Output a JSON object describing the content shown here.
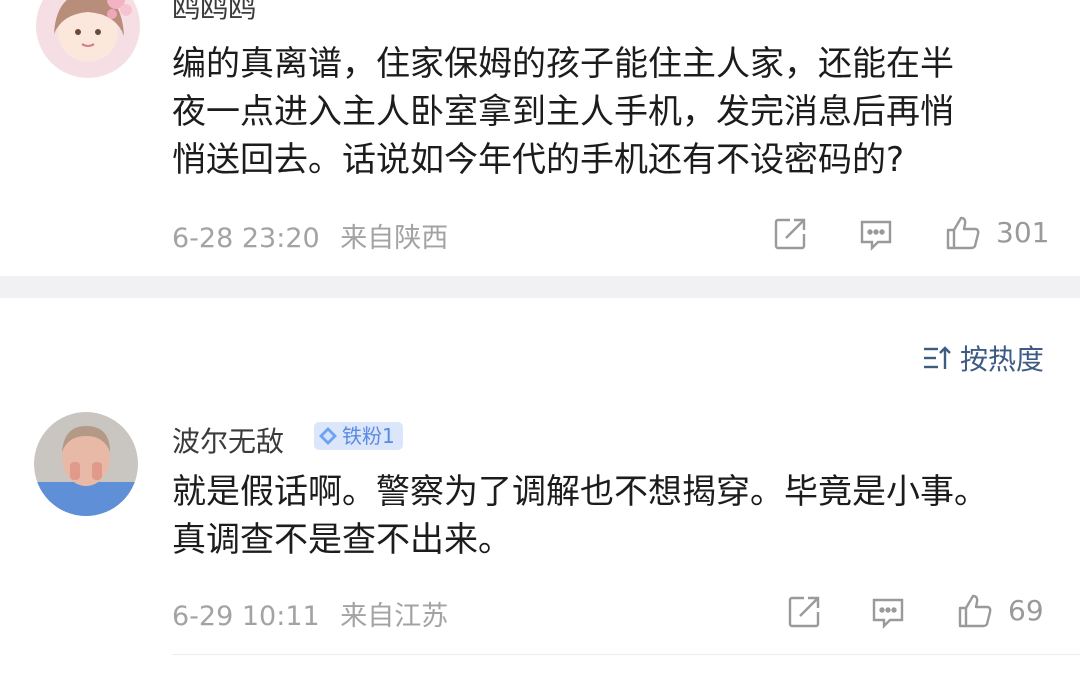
{
  "comments": [
    {
      "username": "鸥鸥鸥",
      "text_lines": [
        "编的真离谱，住家保姆的孩子能住主人家，还能在半",
        "夜一点进入主人卧室拿到主人手机，发完消息后再悄",
        "悄送回去。话说如今年代的手机还有不设密码的?"
      ],
      "time": "6-28 23:20",
      "location": "来自陕西",
      "likes": "301"
    },
    {
      "username": "波尔无敌",
      "badge": "铁粉1",
      "text_lines": [
        "就是假话啊。警察为了调解也不想揭穿。毕竟是小事。",
        "真调查不是查不出来。"
      ],
      "time": "6-29 10:11",
      "location": "来自江苏",
      "likes": "69"
    }
  ],
  "sort": {
    "label": "按热度",
    "icon": "sort-icon"
  },
  "icons": {
    "share": "share-icon",
    "comment": "comment-icon",
    "like": "thumbs-up-icon"
  },
  "colors": {
    "accent_blue": "#3e5b84",
    "badge_bg": "#dbe6fb",
    "badge_text": "#5a8be0",
    "meta_gray": "#a3a3a3",
    "band": "#f1f1f3"
  }
}
